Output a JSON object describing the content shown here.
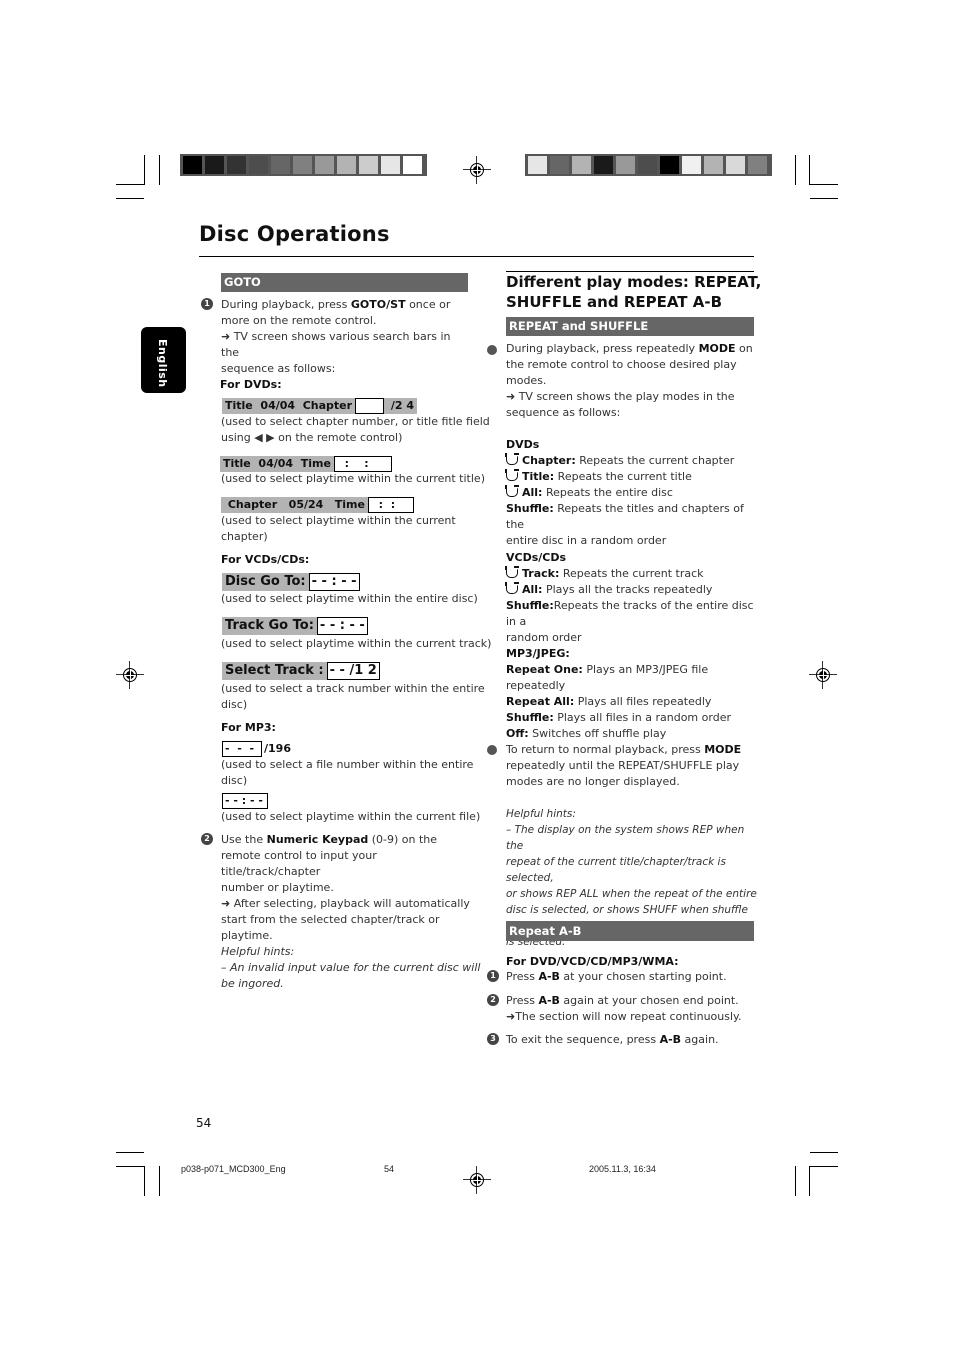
{
  "color_bars": {
    "left": [
      "#000000",
      "#1a1a1a",
      "#333333",
      "#4d4d4d",
      "#666666",
      "#808080",
      "#999999",
      "#b3b3b3",
      "#cccccc",
      "#e6e6e6",
      "#ffffff"
    ],
    "right": [
      "#e6e6e6",
      "#666666",
      "#b3b3b3",
      "#1a1a1a",
      "#999999",
      "#4d4d4d",
      "#000000",
      "#f0f0f0",
      "#b3b3b3",
      "#d9d9d9",
      "#808080"
    ]
  },
  "page_title": "Disc Operations",
  "language_tab": "English",
  "left": {
    "goto_header": "GOTO",
    "step1": {
      "num": "1",
      "pre": "During playback, press ",
      "key": "GOTO/ST",
      "post": " once or",
      "line2": "more on the remote control.",
      "line3": "➜ TV screen shows various search bars in the",
      "line4": "sequence as follows:"
    },
    "for_dvds": "For DVDs:",
    "dvd_bars": [
      {
        "label": "Title  04/04  Chapter",
        "box": "      ",
        "tail": " /2 4",
        "desc1": "(used to select chapter number, or title fitle field",
        "desc2": "using ◀ ▶  on the remote control)"
      },
      {
        "label": "Title  04/04  Time",
        "box": "  :    :   ",
        "desc1": "(used to select playtime within the current title)"
      },
      {
        "label": " Chapter   05/24   Time",
        "box": "  :  :  ",
        "desc1": "(used to select playtime within the current",
        "desc2": "chapter)"
      }
    ],
    "for_vcds": "For VCDs/CDs:",
    "vcd_bars": [
      {
        "label": "Disc Go To:",
        "box": "- - : - -",
        "desc1": "(used to select playtime within the entire disc)"
      },
      {
        "label": "Track Go To:",
        "box": "- - : - -",
        "desc1": "(used to select playtime within the current track)"
      },
      {
        "label": "Select Track :",
        "box": "- - /1 2",
        "desc1": "(used to select a track number within the entire",
        "desc2": "disc)"
      }
    ],
    "for_mp3": "For MP3:",
    "mp3_bars": [
      {
        "box": "-  -  -",
        "tail": "/196",
        "desc1": "(used to select a file number within the entire",
        "desc2": "disc)"
      },
      {
        "box": "- - : - -",
        "desc1": "(used to select playtime within the current file)"
      }
    ],
    "step2": {
      "num": "2",
      "pre": "Use the ",
      "key": "Numeric Keypad",
      "post": " (0-9) on the",
      "line2": "remote control to input your title/track/chapter",
      "line3": "number or playtime.",
      "line4": "➜ After selecting, playback will automatically",
      "line5": "start from the selected chapter/track or",
      "line6": "playtime."
    },
    "hints_title": "Helpful hints:",
    "hints_line1": "–   An invalid input value for the current disc will",
    "hints_line2": "be ingored."
  },
  "right": {
    "heading_line1": "Different play modes: REPEAT,",
    "heading_line2": "SHUFFLE and REPEAT A-B",
    "repeat_shuffle_header": "REPEAT and SHUFFLE",
    "bullet1": {
      "pre": "During playback, press repeatedly ",
      "key": "MODE",
      "post": " on",
      "line2": "the remote control to choose desired play",
      "line3": "modes.",
      "line4": "➜ TV screen shows the play modes in the",
      "line5": "sequence as follows:"
    },
    "dvds": {
      "title": "DVDs",
      "items": [
        {
          "icon": true,
          "label": "Chapter:",
          "text": " Repeats the current chapter"
        },
        {
          "icon": true,
          "label": "Title:",
          "text": " Repeats the current title"
        },
        {
          "icon": true,
          "label": "All:",
          "text": " Repeats the entire disc"
        },
        {
          "icon": false,
          "label": "Shuffle:",
          "text": " Repeats the titles and chapters of the"
        }
      ],
      "shuffle_line2": "entire disc in a random order"
    },
    "vcds": {
      "title": "VCDs/CDs",
      "items": [
        {
          "icon": true,
          "label": "Track:",
          "text": " Repeats the current track"
        },
        {
          "icon": true,
          "label": "All:",
          "text": " Plays all the tracks repeatedly"
        },
        {
          "icon": false,
          "label": "Shuffle:",
          "text": "Repeats the tracks of the entire disc in a"
        }
      ],
      "shuffle_line2": "random order"
    },
    "mp3": {
      "title": "MP3/JPEG:",
      "items": [
        {
          "label": "Repeat One:",
          "text": " Plays an MP3/JPEG file repeatedly"
        },
        {
          "label": "Repeat All:",
          "text": " Plays all files repeatedly"
        },
        {
          "label": "Shuffle:",
          "text": " Plays all files in a random order"
        },
        {
          "label": "Off:",
          "text": " Switches off shuffle play"
        }
      ]
    },
    "bullet2": {
      "pre": "To return to normal playback, press ",
      "key": "MODE",
      "line2": "repeatedly until the REPEAT/SHUFFLE play",
      "line3": "modes are no longer displayed."
    },
    "hints_title": "Helpful hints:",
    "hints_lines": [
      " –  The display on the system shows REP when the",
      "repeat of the current title/chapter/track is selected,",
      "or shows REP ALL when the repeat of the entire",
      "disc is selected, or shows SHUFF when shuffle play",
      "is selected."
    ],
    "ab_header": "Repeat A-B",
    "ab_for": "For DVD/VCD/CD/MP3/WMA:",
    "ab_steps": [
      {
        "num": "1",
        "pre": "Press ",
        "key": "A-B",
        "post": " at your chosen starting point."
      },
      {
        "num": "2",
        "pre": "Press ",
        "key": "A-B",
        "post": " again at your chosen end point.",
        "line2": "➜The section will now repeat continuously."
      },
      {
        "num": "3",
        "pre": "To exit the sequence, press ",
        "key": "A-B",
        "post": " again."
      }
    ]
  },
  "page_number": "54",
  "footer": {
    "file": "p038-p071_MCD300_Eng",
    "page": "54",
    "date": "2005.11.3, 16:34"
  }
}
